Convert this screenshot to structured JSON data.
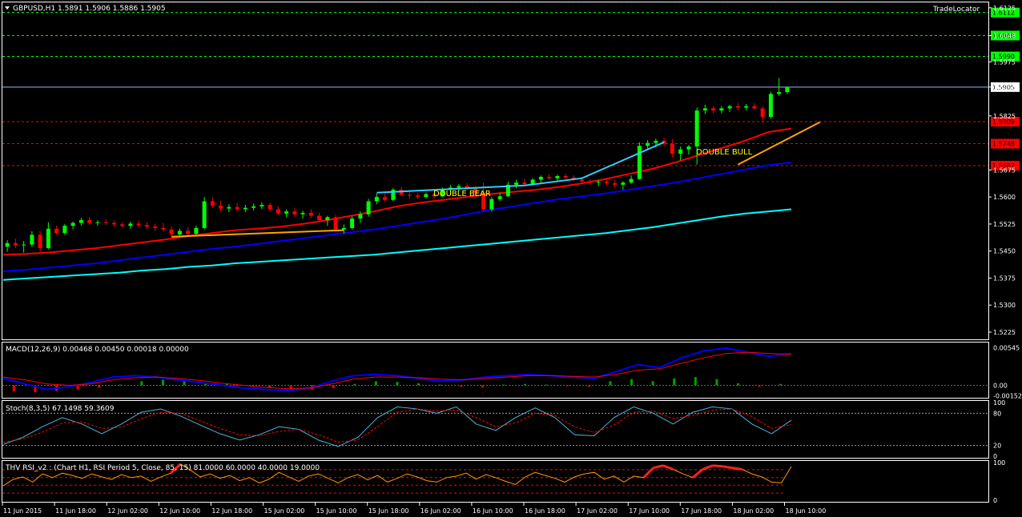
{
  "window": {
    "symbol_header": "GBPUSD,H1  1.5891 1.5906 1.5886 1.5905",
    "brand": "TradeLocator"
  },
  "colors": {
    "background": "#000000",
    "frame": "#ffffff",
    "bull_candle": "#00ff00",
    "bear_candle": "#ff0000",
    "ma_fast": "#ff0000",
    "ma_mid": "#0000ff",
    "ma_slow": "#00ffff",
    "level_green": "#00ff00",
    "level_red": "#ff0000",
    "level_blue": "#00ffff",
    "divergence_bear": "#33ccff",
    "divergence_bull": "#ffa500",
    "annotation": "#ffff00"
  },
  "chart_data": [
    {
      "type": "candlestick",
      "pane": "price",
      "title": "GBPUSD,H1  1.5891 1.5906 1.5886 1.5905",
      "ylim": [
        1.5205,
        1.614
      ],
      "y_ticks": [
        "1.6125",
        "1.6048",
        "1.5975",
        "1.5905",
        "1.5825",
        "1.5675",
        "1.5600",
        "1.5525",
        "1.5450",
        "1.5375",
        "1.5300",
        "1.5225"
      ],
      "last_price": 1.5905,
      "candles": [
        [
          1.5462,
          1.548,
          1.5448,
          1.5472
        ],
        [
          1.5472,
          1.5485,
          1.5458,
          1.5466
        ],
        [
          1.5466,
          1.5478,
          1.5446,
          1.5468
        ],
        [
          1.5468,
          1.5505,
          1.5462,
          1.5495
        ],
        [
          1.5495,
          1.5505,
          1.5448,
          1.5458
        ],
        [
          1.5458,
          1.553,
          1.5455,
          1.5512
        ],
        [
          1.5512,
          1.552,
          1.5495,
          1.55
        ],
        [
          1.55,
          1.5525,
          1.5495,
          1.552
        ],
        [
          1.552,
          1.5532,
          1.551,
          1.5528
        ],
        [
          1.5528,
          1.5542,
          1.552,
          1.5536
        ],
        [
          1.5536,
          1.5545,
          1.5522,
          1.5528
        ],
        [
          1.5528,
          1.5535,
          1.552,
          1.553
        ],
        [
          1.553,
          1.5538,
          1.5522,
          1.5528
        ],
        [
          1.5528,
          1.5535,
          1.5518,
          1.5524
        ],
        [
          1.5524,
          1.553,
          1.5515,
          1.552
        ],
        [
          1.552,
          1.5532,
          1.5512,
          1.5526
        ],
        [
          1.5526,
          1.5535,
          1.5516,
          1.5522
        ],
        [
          1.5522,
          1.553,
          1.5512,
          1.5518
        ],
        [
          1.5518,
          1.5526,
          1.5506,
          1.5514
        ],
        [
          1.5514,
          1.5528,
          1.5504,
          1.551
        ],
        [
          1.551,
          1.5518,
          1.549,
          1.5496
        ],
        [
          1.5496,
          1.5512,
          1.5488,
          1.5506
        ],
        [
          1.5506,
          1.5516,
          1.5492,
          1.5498
        ],
        [
          1.5498,
          1.552,
          1.5494,
          1.5514
        ],
        [
          1.5514,
          1.56,
          1.551,
          1.5588
        ],
        [
          1.5588,
          1.56,
          1.557,
          1.5576
        ],
        [
          1.5576,
          1.559,
          1.556,
          1.5568
        ],
        [
          1.5568,
          1.558,
          1.5558,
          1.5572
        ],
        [
          1.5572,
          1.5582,
          1.556,
          1.5566
        ],
        [
          1.5566,
          1.5578,
          1.5558,
          1.557
        ],
        [
          1.557,
          1.5582,
          1.5562,
          1.5574
        ],
        [
          1.5574,
          1.5586,
          1.5566,
          1.5578
        ],
        [
          1.5578,
          1.5584,
          1.556,
          1.5566
        ],
        [
          1.5566,
          1.5574,
          1.555,
          1.5554
        ],
        [
          1.5554,
          1.5566,
          1.5544,
          1.556
        ],
        [
          1.556,
          1.557,
          1.5546,
          1.5552
        ],
        [
          1.5552,
          1.5562,
          1.554,
          1.5556
        ],
        [
          1.5556,
          1.5566,
          1.5542,
          1.5548
        ],
        [
          1.5548,
          1.5556,
          1.553,
          1.5536
        ],
        [
          1.5536,
          1.5548,
          1.552,
          1.5544
        ],
        [
          1.5544,
          1.555,
          1.5504,
          1.551
        ],
        [
          1.551,
          1.5524,
          1.5498,
          1.5514
        ],
        [
          1.5514,
          1.5546,
          1.551,
          1.554
        ],
        [
          1.554,
          1.556,
          1.5528,
          1.5552
        ],
        [
          1.5552,
          1.5595,
          1.5545,
          1.5588
        ],
        [
          1.5588,
          1.561,
          1.558,
          1.56
        ],
        [
          1.56,
          1.5612,
          1.5586,
          1.5592
        ],
        [
          1.5592,
          1.5625,
          1.5588,
          1.562
        ],
        [
          1.562,
          1.5628,
          1.5602,
          1.5606
        ],
        [
          1.5606,
          1.5614,
          1.5596,
          1.5604
        ],
        [
          1.5604,
          1.5612,
          1.5594,
          1.56
        ],
        [
          1.56,
          1.5612,
          1.5596,
          1.5608
        ],
        [
          1.5608,
          1.5614,
          1.5596,
          1.5602
        ],
        [
          1.5602,
          1.5626,
          1.56,
          1.562
        ],
        [
          1.562,
          1.5634,
          1.561,
          1.5626
        ],
        [
          1.5626,
          1.5636,
          1.5616,
          1.563
        ],
        [
          1.563,
          1.5638,
          1.562,
          1.5626
        ],
        [
          1.5626,
          1.563,
          1.56,
          1.5612
        ],
        [
          1.5612,
          1.564,
          1.556,
          1.5566
        ],
        [
          1.5566,
          1.56,
          1.556,
          1.5594
        ],
        [
          1.5594,
          1.5612,
          1.5588,
          1.5602
        ],
        [
          1.5602,
          1.5642,
          1.56,
          1.5634
        ],
        [
          1.5634,
          1.5648,
          1.5624,
          1.564
        ],
        [
          1.564,
          1.565,
          1.563,
          1.5636
        ],
        [
          1.5636,
          1.5652,
          1.5632,
          1.5648
        ],
        [
          1.5648,
          1.566,
          1.564,
          1.5656
        ],
        [
          1.5656,
          1.5664,
          1.5648,
          1.5652
        ],
        [
          1.5652,
          1.5662,
          1.5644,
          1.5658
        ],
        [
          1.5658,
          1.5664,
          1.565,
          1.5654
        ],
        [
          1.5654,
          1.566,
          1.5644,
          1.5648
        ],
        [
          1.5648,
          1.5654,
          1.5638,
          1.5644
        ],
        [
          1.5644,
          1.565,
          1.5634,
          1.564
        ],
        [
          1.564,
          1.5648,
          1.563,
          1.5642
        ],
        [
          1.5642,
          1.565,
          1.5632,
          1.5638
        ],
        [
          1.5638,
          1.5646,
          1.5626,
          1.5634
        ],
        [
          1.5634,
          1.5644,
          1.562,
          1.564
        ],
        [
          1.564,
          1.566,
          1.5636,
          1.565
        ],
        [
          1.565,
          1.5752,
          1.5648,
          1.5742
        ],
        [
          1.5742,
          1.5758,
          1.573,
          1.575
        ],
        [
          1.575,
          1.5762,
          1.5738,
          1.5756
        ],
        [
          1.5756,
          1.5764,
          1.574,
          1.5748
        ],
        [
          1.5748,
          1.576,
          1.571,
          1.572
        ],
        [
          1.572,
          1.574,
          1.5702,
          1.5732
        ],
        [
          1.5732,
          1.5744,
          1.5718,
          1.574
        ],
        [
          1.574,
          1.5848,
          1.569,
          1.584
        ],
        [
          1.584,
          1.5856,
          1.583,
          1.5846
        ],
        [
          1.5846,
          1.5852,
          1.5832,
          1.584
        ],
        [
          1.584,
          1.5852,
          1.5832,
          1.5846
        ],
        [
          1.5846,
          1.5856,
          1.5836,
          1.5852
        ],
        [
          1.5852,
          1.586,
          1.584,
          1.5848
        ],
        [
          1.5848,
          1.5858,
          1.584,
          1.5852
        ],
        [
          1.5852,
          1.586,
          1.5842,
          1.5846
        ],
        [
          1.5846,
          1.5852,
          1.5808,
          1.5822
        ],
        [
          1.5822,
          1.5892,
          1.5818,
          1.5886
        ],
        [
          1.5886,
          1.593,
          1.588,
          1.5891
        ],
        [
          1.5891,
          1.5906,
          1.5886,
          1.5905
        ]
      ],
      "ma_fast": [
        1.544,
        1.5442,
        1.5446,
        1.5452,
        1.5458,
        1.5466,
        1.5474,
        1.5482,
        1.5492,
        1.55,
        1.5508,
        1.5512,
        1.5518,
        1.5526,
        1.5536,
        1.5548,
        1.556,
        1.5574,
        1.5584,
        1.5592,
        1.56,
        1.5608,
        1.5614,
        1.562,
        1.5628,
        1.5638,
        1.565,
        1.5664,
        1.5678,
        1.5696,
        1.5716,
        1.5736,
        1.5756,
        1.578,
        1.579
      ],
      "ma_mid": [
        1.5394,
        1.5398,
        1.5404,
        1.541,
        1.5416,
        1.5424,
        1.5432,
        1.544,
        1.5448,
        1.5456,
        1.5462,
        1.547,
        1.5478,
        1.5486,
        1.5494,
        1.5502,
        1.551,
        1.552,
        1.553,
        1.554,
        1.5552,
        1.5564,
        1.5574,
        1.5584,
        1.5594,
        1.5602,
        1.561,
        1.562,
        1.563,
        1.564,
        1.5652,
        1.5664,
        1.5676,
        1.5688,
        1.5696
      ],
      "ma_slow": [
        1.537,
        1.5374,
        1.5378,
        1.5382,
        1.5386,
        1.539,
        1.5396,
        1.54,
        1.5406,
        1.541,
        1.5416,
        1.542,
        1.5424,
        1.5428,
        1.5432,
        1.5436,
        1.544,
        1.5446,
        1.5452,
        1.5458,
        1.5464,
        1.547,
        1.5476,
        1.5482,
        1.5488,
        1.5494,
        1.55,
        1.5508,
        1.5516,
        1.5526,
        1.5536,
        1.5546,
        1.5554,
        1.556,
        1.5566
      ],
      "horizontal_levels": [
        {
          "value": 1.6112,
          "label": "1.6112",
          "color": "#00ff00"
        },
        {
          "value": 1.6048,
          "label": "1.6048",
          "color": "#00ff00"
        },
        {
          "value": 1.599,
          "label": "1.5990",
          "color": "#00ff00"
        },
        {
          "value": 1.5809,
          "label": "1.5809",
          "color": "#ff0000"
        },
        {
          "value": 1.5748,
          "label": "1.5748",
          "color": "#ff0000"
        },
        {
          "value": 1.5687,
          "label": "1.5687",
          "color": "#ff0000"
        }
      ],
      "annotations": [
        "DOUBLE BEAR",
        "DOUBLE BULL"
      ],
      "trendlines": [
        {
          "color": "#33ccff",
          "points": [
            [
              45,
              1.5612
            ],
            [
              63,
              1.5632
            ],
            [
              70,
              1.5652
            ],
            [
              80,
              1.5752
            ]
          ]
        },
        {
          "color": "#ffa500",
          "points": [
            [
              20,
              1.549
            ],
            [
              41,
              1.5508
            ]
          ]
        },
        {
          "color": "#ffa500",
          "points": [
            [
              89,
              1.569
            ],
            [
              99,
              1.5808
            ]
          ]
        }
      ]
    },
    {
      "type": "macd",
      "pane": "MACD",
      "title": "MACD(12,26,9) 0.00468 0.00450 0.00018 0.00000",
      "params": "12,26,9",
      "values": {
        "macd": 0.00468,
        "signal": 0.0045,
        "histogram": 0.00018,
        "zero": 0.0
      },
      "ylim": [
        -0.0018,
        0.0062
      ],
      "y_ticks": [
        "0.00545",
        "0.00",
        "-0.00152"
      ],
      "histogram_series": [
        -0.0009,
        -0.001,
        -0.0008,
        -0.0006,
        -0.0003,
        0.0001,
        0.0006,
        0.0008,
        0.0006,
        0.0004,
        0.0002,
        -0.0001,
        -0.0003,
        -0.0005,
        -0.0006,
        -0.0004,
        0.0002,
        0.0006,
        0.0005,
        0.0003,
        0.0001,
        -0.0002,
        -0.0003,
        0.0001,
        0.0002,
        0.0001,
        -0.0001,
        -0.0002,
        0.0006,
        0.0009,
        0.0006,
        0.001,
        0.0012,
        0.0009,
        0.0003,
        -0.0002,
        0.0002
      ],
      "macd_series": [
        0.001,
        0.0002,
        -0.0006,
        -0.0002,
        0.0004,
        0.0012,
        0.0014,
        0.0012,
        0.0008,
        0.0004,
        0.0,
        -0.0004,
        -0.0006,
        -0.0008,
        -0.0004,
        0.0006,
        0.0014,
        0.0016,
        0.0014,
        0.001,
        0.0006,
        0.0008,
        0.0012,
        0.0014,
        0.0016,
        0.0014,
        0.0012,
        0.001,
        0.002,
        0.003,
        0.0026,
        0.004,
        0.005,
        0.0054,
        0.0048,
        0.0042,
        0.0046
      ],
      "signal_series": [
        0.0012,
        0.0008,
        0.0002,
        0.0,
        0.0002,
        0.0008,
        0.0011,
        0.0012,
        0.001,
        0.0007,
        0.0003,
        0.0,
        -0.0003,
        -0.0005,
        -0.0004,
        0.0002,
        0.0009,
        0.0012,
        0.0012,
        0.0011,
        0.0009,
        0.0008,
        0.001,
        0.0012,
        0.0014,
        0.0014,
        0.0013,
        0.0012,
        0.0016,
        0.0022,
        0.0024,
        0.0032,
        0.004,
        0.0046,
        0.0048,
        0.0046,
        0.0045
      ]
    },
    {
      "type": "stochastic",
      "pane": "Stoch",
      "title": "Stoch(8,3,5) 67.1498 59.3609",
      "params": "8,3,5",
      "values": {
        "k": 67.1498,
        "d": 59.3609
      },
      "ylim": [
        0,
        100
      ],
      "levels": [
        80,
        20
      ],
      "y_ticks": [
        "100",
        "80",
        "20",
        "0"
      ],
      "k_series": [
        22,
        35,
        55,
        72,
        60,
        42,
        60,
        82,
        88,
        75,
        58,
        42,
        30,
        40,
        55,
        50,
        30,
        18,
        35,
        72,
        92,
        88,
        80,
        92,
        60,
        48,
        72,
        90,
        72,
        40,
        38,
        72,
        92,
        80,
        60,
        82,
        92,
        88,
        60,
        42,
        67
      ],
      "d_series": [
        26,
        32,
        45,
        62,
        64,
        52,
        54,
        70,
        82,
        80,
        66,
        52,
        40,
        38,
        46,
        50,
        40,
        26,
        30,
        55,
        82,
        88,
        84,
        86,
        72,
        55,
        62,
        80,
        76,
        55,
        44,
        58,
        82,
        84,
        70,
        76,
        86,
        88,
        74,
        52,
        59
      ]
    },
    {
      "type": "line",
      "pane": "RSI",
      "title": "THV RSI_v2 : (Chart H1,  RSI Period 5,  Close,  85,  15) 81.0000 60.0000 40.0000 19.0000",
      "params": "Chart H1, RSI Period 5, Close, 85, 15",
      "values": [
        81.0,
        60.0,
        40.0,
        19.0
      ],
      "ylim": [
        0,
        100
      ],
      "levels": [
        81,
        60,
        40,
        19
      ],
      "y_ticks": [
        "100",
        "0"
      ],
      "rsi_series": [
        38,
        55,
        62,
        48,
        70,
        60,
        72,
        66,
        58,
        70,
        62,
        55,
        68,
        60,
        64,
        50,
        62,
        72,
        96,
        80,
        62,
        70,
        58,
        66,
        52,
        60,
        46,
        56,
        74,
        62,
        50,
        64,
        70,
        58,
        46,
        60,
        68,
        54,
        66,
        48,
        58,
        70,
        62,
        52,
        48,
        60,
        64,
        72,
        56,
        68,
        60,
        50,
        42,
        62,
        74,
        66,
        58,
        48,
        62,
        70,
        74,
        56,
        64,
        48,
        64,
        60,
        86,
        92,
        82,
        70,
        60,
        82,
        92,
        90,
        86,
        82,
        70,
        62,
        48,
        46,
        90
      ]
    },
    {
      "type": "axis",
      "pane": "time",
      "x_ticks": [
        "11 Jun 2015",
        "11 Jun 18:00",
        "12 Jun 02:00",
        "12 Jun 10:00",
        "12 Jun 18:00",
        "15 Jun 02:00",
        "15 Jun 10:00",
        "15 Jun 18:00",
        "16 Jun 02:00",
        "16 Jun 10:00",
        "16 Jun 18:00",
        "17 Jun 02:00",
        "17 Jun 10:00",
        "17 Jun 18:00",
        "18 Jun 02:00",
        "18 Jun 10:00"
      ]
    }
  ]
}
